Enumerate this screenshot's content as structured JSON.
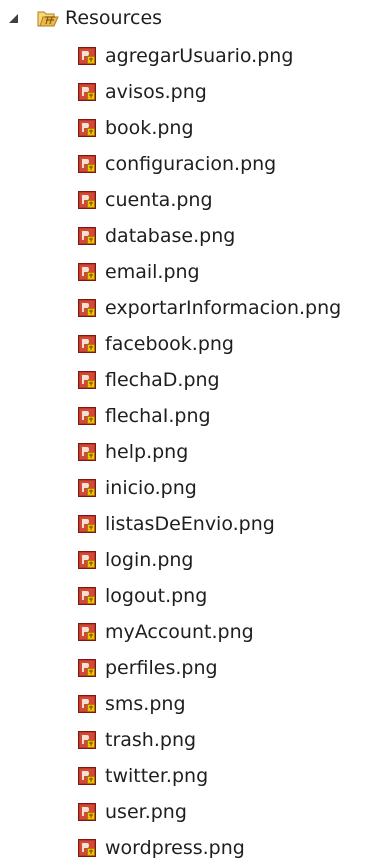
{
  "tree": {
    "folder": {
      "label": "Resources",
      "expanded": true,
      "expander_icon": "expanded-triangle-icon",
      "icon": "open-folder-icon"
    },
    "file_icon": "image-file-icon",
    "files": [
      "agregarUsuario.png",
      "avisos.png",
      "book.png",
      "configuracion.png",
      "cuenta.png",
      "database.png",
      "email.png",
      "exportarInformacion.png",
      "facebook.png",
      "flechaD.png",
      "flechaI.png",
      "help.png",
      "inicio.png",
      "listasDeEnvio.png",
      "login.png",
      "logout.png",
      "myAccount.png",
      "perfiles.png",
      "sms.png",
      "trash.png",
      "twitter.png",
      "user.png",
      "wordpress.png"
    ]
  },
  "colors": {
    "text": "#1e1e1e",
    "background": "#ffffff",
    "folder_fill": "#f7d77a",
    "folder_stroke": "#c8962e",
    "image_icon_red": "#b5281e",
    "image_icon_yellow": "#f5c400"
  }
}
